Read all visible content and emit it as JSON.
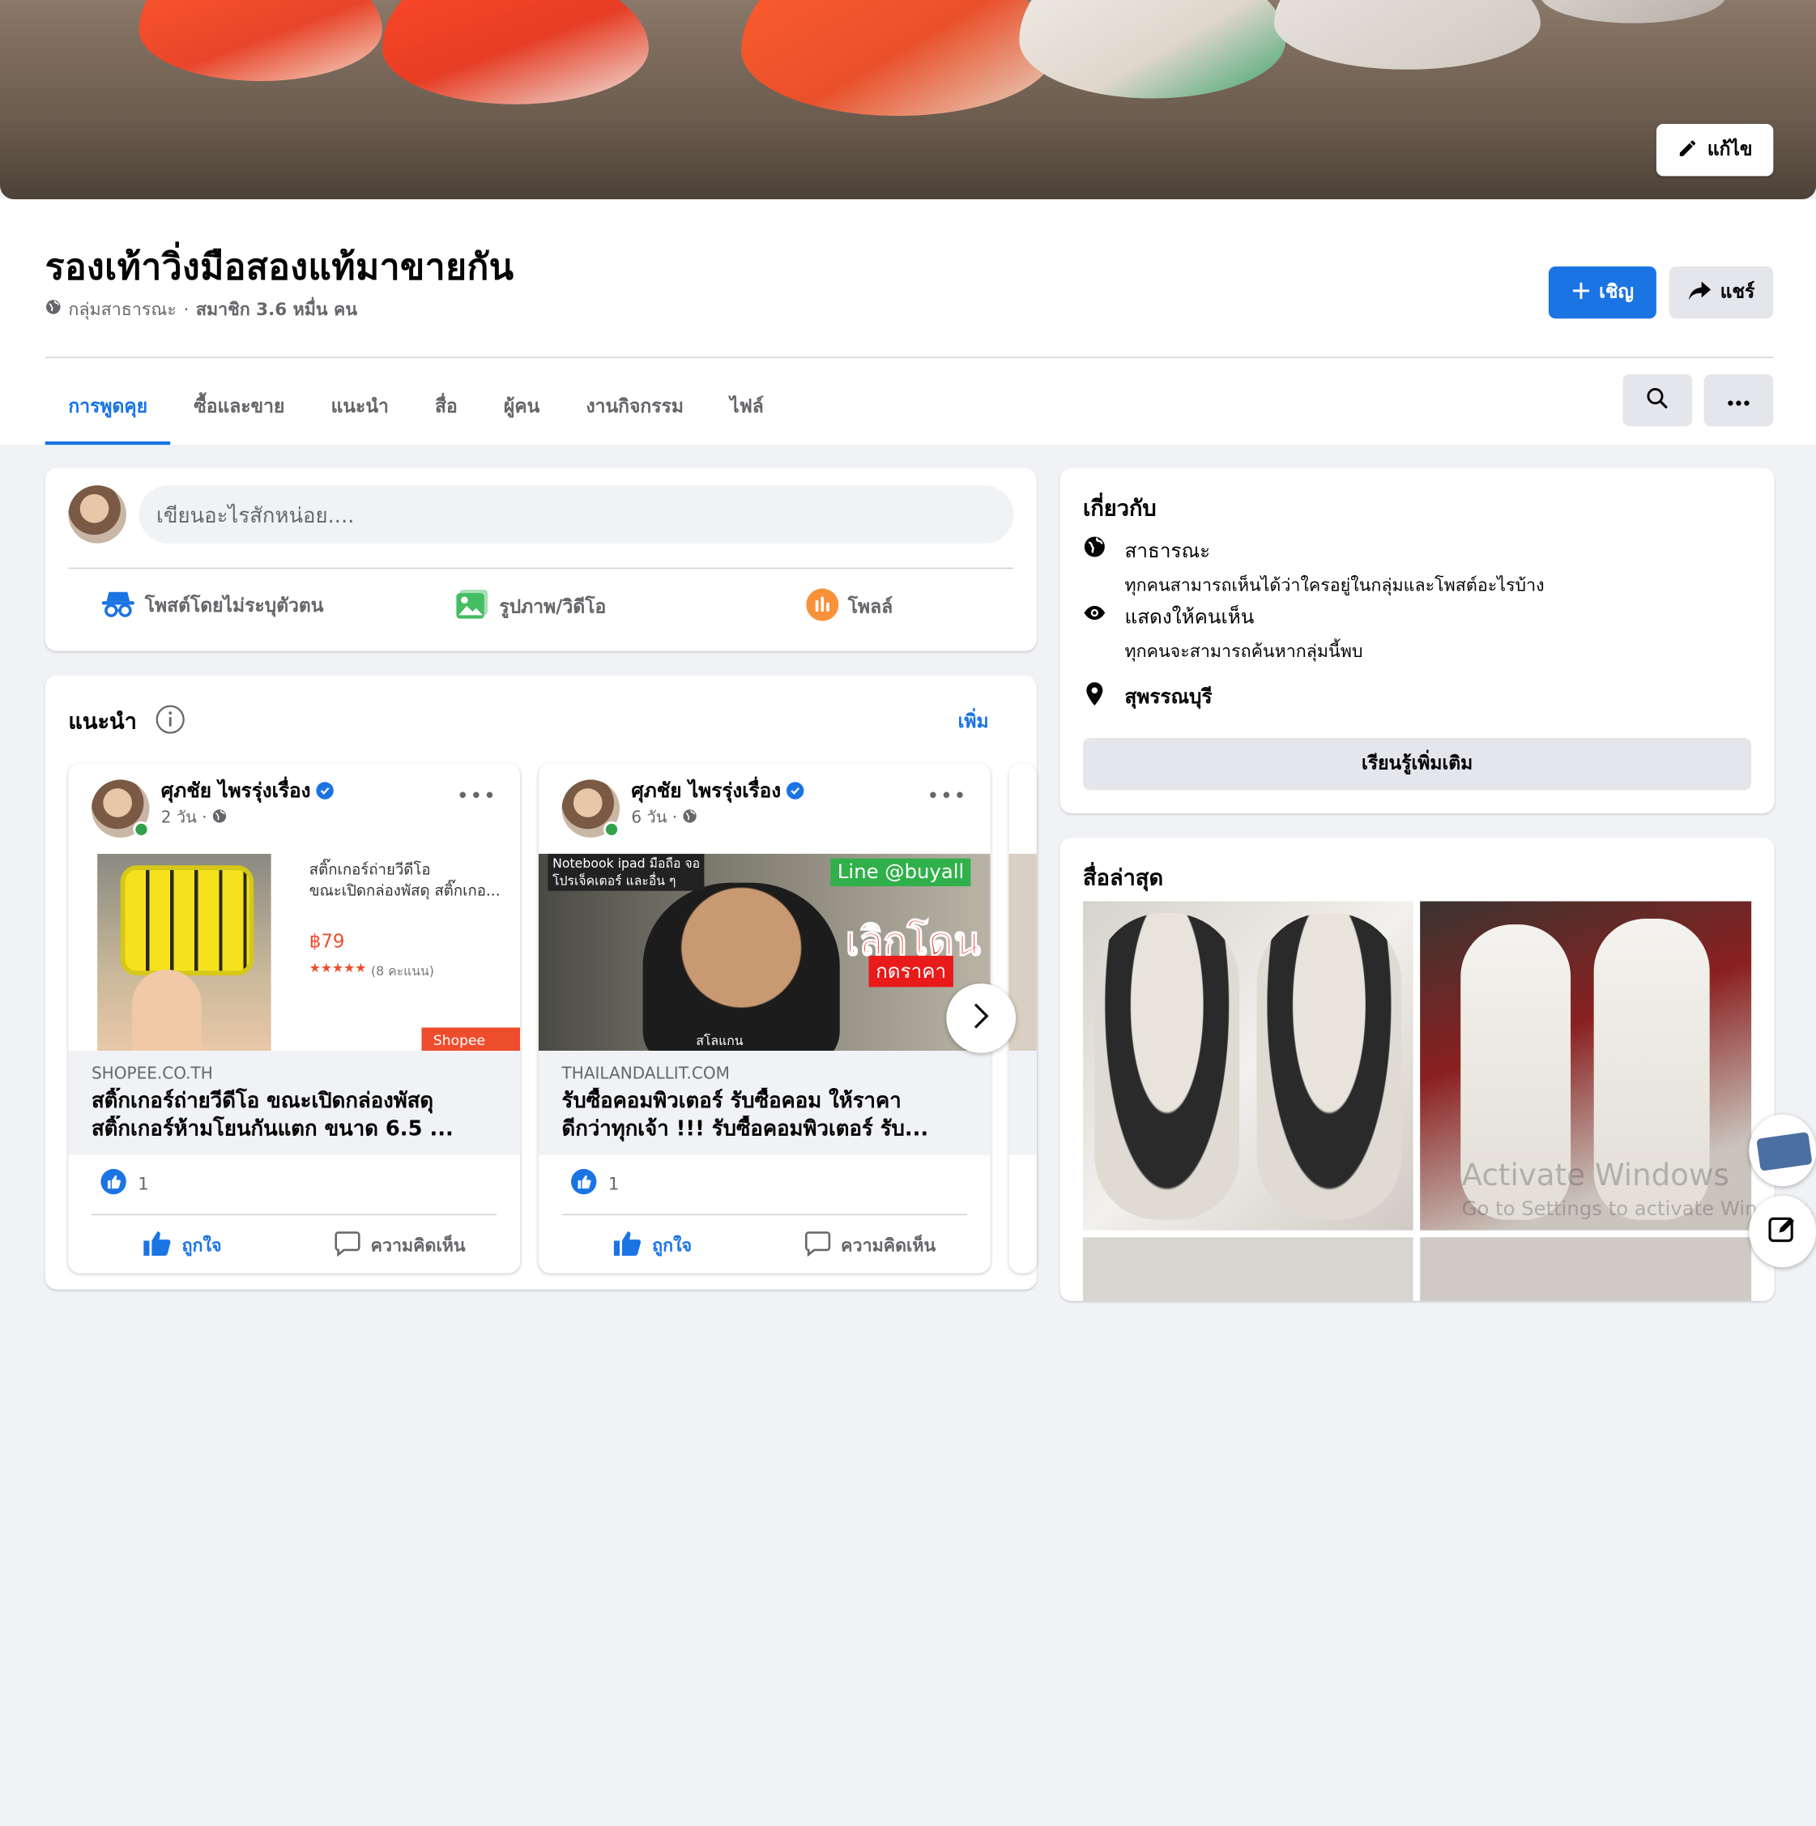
{
  "cover": {
    "edit_label": "แก้ไข"
  },
  "group": {
    "title": "รองเท้าวิ่งมือสองแท้มาขายกัน",
    "privacy": "กลุ่มสาธารณะ",
    "separator": "·",
    "members": "สมาชิก 3.6 หมื่น คน"
  },
  "actions": {
    "invite": "เชิญ",
    "share": "แชร์"
  },
  "tabs": [
    "การพูดคุย",
    "ซื้อและขาย",
    "แนะนำ",
    "สื่อ",
    "ผู้คน",
    "งานกิจกรรม",
    "ไฟล์"
  ],
  "composer": {
    "placeholder": "เขียนอะไรสักหน่อย....",
    "anonymous": "โพสต์โดยไม่ระบุตัวตน",
    "photo": "รูปภาพ/วิดีโอ",
    "poll": "โพลล์"
  },
  "featured": {
    "title": "แนะนำ",
    "more": "เพิ่ม",
    "posts": [
      {
        "author": "ศุภชัย ไพรรุ่งเรื่อง",
        "time": "2 วัน ·",
        "image_caption": "สติ๊กเกอร์ถ่ายวีดีโอ",
        "image_caption2": "ขณะเปิดกล่องพัสดุ สติ๊กเกอ...",
        "price": "฿79",
        "rating": "★★★★★",
        "rating_count": "(8 คะแนน)",
        "shop": "Shopee",
        "domain": "SHOPEE.CO.TH",
        "title_line1": "สติ๊กเกอร์ถ่ายวีดีโอ ขณะเปิดกล่องพัสดุ",
        "title_line2": "สติ๊กเกอร์ห้ามโยนกันแตก ขนาด 6.5 ...",
        "likes": "1",
        "like_label": "ถูกใจ",
        "comment_label": "ความคิดเห็น"
      },
      {
        "author": "ศุภชัย ไพรรุ่งเรื่อง",
        "time": "6 วัน ·",
        "image_text1": "Notebook ipad มือถือ จอ",
        "image_text2": "โปรเจ็คเตอร์ และอื่น ๆ",
        "image_line": "Line @buyall",
        "image_big": "เลิกโดน",
        "image_small": "กดราคา",
        "image_bottom": "สโลแกน",
        "domain": "THAILANDALLIT.COM",
        "title_line1": "รับซื้อคอมพิวเตอร์ รับซื้อคอม ให้ราคา",
        "title_line2": "ดีกว่าทุกเจ้า !!! รับซื้อคอมพิวเตอร์ รับ...",
        "likes": "1",
        "like_label": "ถูกใจ",
        "comment_label": "ความคิดเห็น"
      }
    ]
  },
  "about": {
    "title": "เกี่ยวกับ",
    "public_title": "สาธารณะ",
    "public_desc": "ทุกคนสามารถเห็นได้ว่าใครอยู่ในกลุ่มและโพสต์อะไรบ้าง",
    "visible_title": "แสดงให้คนเห็น",
    "visible_desc": "ทุกคนจะสามารถค้นหากลุ่มนี้พบ",
    "location": "สุพรรณบุรี",
    "learn_more": "เรียนรู้เพิ่มเติม"
  },
  "media": {
    "title": "สื่อล่าสุด"
  },
  "watermark": {
    "line1": "Activate Windows",
    "line2": "Go to Settings to activate Windows."
  },
  "colors": {
    "accent": "#1b74e4",
    "background": "#f0f2f5",
    "like_blue": "#1b74e4",
    "poll_orange": "#f7923b",
    "photo_green": "#45bd62"
  }
}
